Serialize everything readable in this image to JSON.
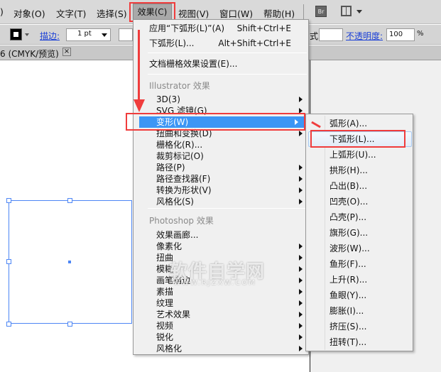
{
  "menubar": {
    "items": [
      {
        "label": ")"
      },
      {
        "label": "对象(O)"
      },
      {
        "label": "文字(T)"
      },
      {
        "label": "选择(S)"
      },
      {
        "label": "效果(C)"
      },
      {
        "label": "视图(V)"
      },
      {
        "label": "窗口(W)"
      },
      {
        "label": "帮助(H)"
      }
    ],
    "bridge_label": "Br"
  },
  "toolbar": {
    "stroke_label": "描边:",
    "stroke_value": "1 pt",
    "style_label": "式:",
    "opacity_label": "不透明度:",
    "opacity_value": "100",
    "percent": "%"
  },
  "tab": {
    "title": "6 (CMYK/预览)",
    "close": "×"
  },
  "effect_menu": {
    "apply": {
      "label": "应用“下弧形(L)”(A)",
      "shortcut": "Shift+Ctrl+E"
    },
    "last": {
      "label": "下弧形(L)...",
      "shortcut": "Alt+Shift+Ctrl+E"
    },
    "doc_raster": "文档栅格效果设置(E)...",
    "illustrator_header": "Illustrator 效果",
    "illustrator_items": [
      "3D(3)",
      "SVG 滤镜(G)",
      "变形(W)",
      "扭曲和变换(D)",
      "栅格化(R)...",
      "裁剪标记(O)",
      "路径(P)",
      "路径查找器(F)",
      "转换为形状(V)",
      "风格化(S)"
    ],
    "photoshop_header": "Photoshop 效果",
    "photoshop_items": [
      "效果画廊...",
      "像素化",
      "扭曲",
      "模糊",
      "画笔描边",
      "素描",
      "纹理",
      "艺术效果",
      "视频",
      "锐化",
      "风格化"
    ]
  },
  "warp_submenu": {
    "items": [
      "弧形(A)...",
      "下弧形(L)...",
      "上弧形(U)...",
      "拱形(H)...",
      "凸出(B)...",
      "凹壳(O)...",
      "凸壳(P)...",
      "旗形(G)...",
      "波形(W)...",
      "鱼形(F)...",
      "上升(R)...",
      "鱼眼(Y)...",
      "膨胀(I)...",
      "挤压(S)...",
      "扭转(T)..."
    ]
  },
  "watermark": {
    "title": "软件自学网",
    "url": "WWW.RJZXW.COM"
  },
  "colors": {
    "highlight": "#3c96f5",
    "annotation": "#f03c3c",
    "selection": "#4d86f5"
  }
}
